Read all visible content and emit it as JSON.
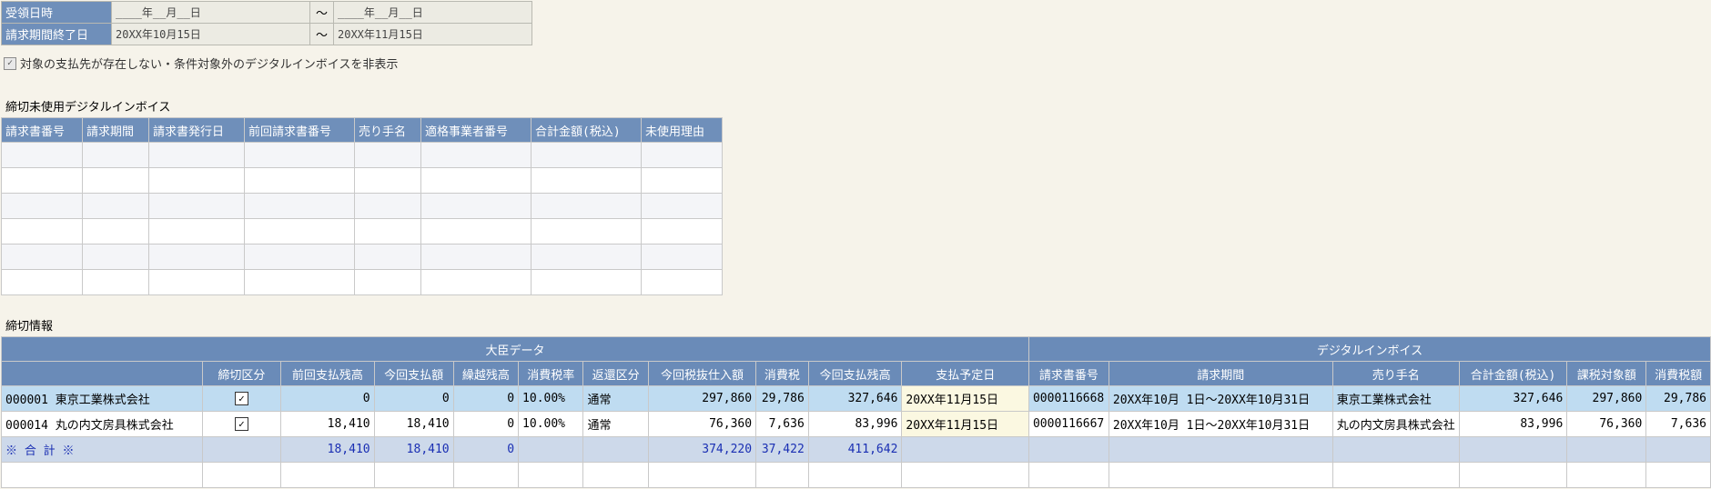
{
  "filter": {
    "received_label": "受領日時",
    "received_from": "____年__月__日",
    "received_to": "____年__月__日",
    "period_end_label": "請求期間終了日",
    "period_end_from": "20XX年10月15日",
    "period_end_to": "20XX年11月15日",
    "tilde": "～"
  },
  "hide_option": {
    "checked": true,
    "check_glyph": "✓",
    "label": "対象の支払先が存在しない・条件対象外のデジタルインボイスを非表示"
  },
  "unused": {
    "title": "締切未使用デジタルインボイス",
    "columns": [
      "請求書番号",
      "請求期間",
      "請求書発行日",
      "前回請求書番号",
      "売り手名",
      "適格事業者番号",
      "合計金額(税込)",
      "未使用理由"
    ]
  },
  "closing": {
    "title": "締切情報",
    "group_daijin": "大臣データ",
    "group_digital": "デジタルインボイス",
    "columns_daijin": [
      "締切区分",
      "前回支払残高",
      "今回支払額",
      "繰越残高",
      "消費税率",
      "返還区分",
      "今回税抜仕入額",
      "消費税",
      "今回支払残高",
      "支払予定日"
    ],
    "columns_digital": [
      "請求書番号",
      "請求期間",
      "売り手名",
      "合計金額(税込)",
      "課税対象額",
      "消費税額"
    ],
    "check_glyph": "✓",
    "rows": [
      {
        "vendor": "000001 東京工業株式会社",
        "prev": "0",
        "pay": "0",
        "carry": "0",
        "rate": "10.00%",
        "ret": "通常",
        "net": "297,860",
        "tax": "29,786",
        "bal": "327,646",
        "due": "20XX年11月15日",
        "inv_no": "0000116668",
        "inv_period": "20XX年10月 1日～20XX年10月31日",
        "seller": "東京工業株式会社",
        "total": "327,646",
        "taxable": "297,860",
        "inv_tax": "29,786"
      },
      {
        "vendor": "000014 丸の内文房具株式会社",
        "prev": "18,410",
        "pay": "18,410",
        "carry": "0",
        "rate": "10.00%",
        "ret": "通常",
        "net": "76,360",
        "tax": "7,636",
        "bal": "83,996",
        "due": "20XX年11月15日",
        "inv_no": "0000116667",
        "inv_period": "20XX年10月 1日～20XX年10月31日",
        "seller": "丸の内文房具株式会社",
        "total": "83,996",
        "taxable": "76,360",
        "inv_tax": "7,636"
      }
    ],
    "total": {
      "label": "※ 合 計 ※",
      "prev": "18,410",
      "pay": "18,410",
      "carry": "0",
      "net": "374,220",
      "tax": "37,422",
      "bal": "411,642"
    }
  }
}
